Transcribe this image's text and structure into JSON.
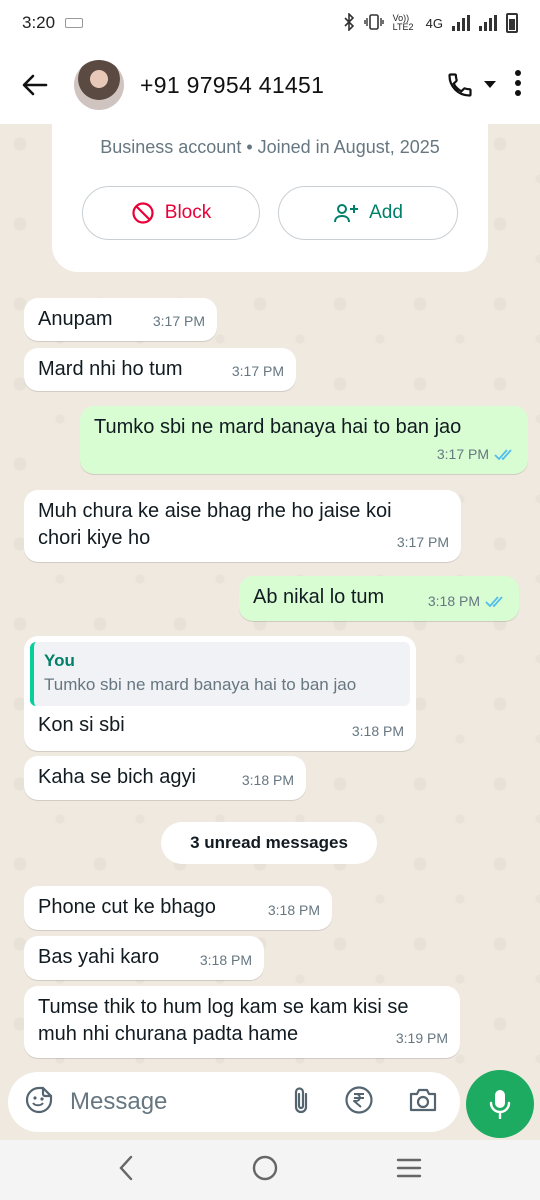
{
  "status_bar": {
    "time": "3:20",
    "network_label": "Vo)) LTE2",
    "network_type": "4G"
  },
  "header": {
    "contact": "+91 97954 41451"
  },
  "business_card": {
    "info": "Business account • Joined in August, 2025",
    "block_label": "Block",
    "add_label": "Add"
  },
  "messages": [
    {
      "direction": "in",
      "text": "Anupam",
      "time": "3:17 PM"
    },
    {
      "direction": "in",
      "text": "Mard nhi ho tum",
      "time": "3:17 PM"
    },
    {
      "direction": "out",
      "text": "Tumko sbi ne mard banaya hai to ban jao",
      "time": "3:17 PM",
      "status": "read"
    },
    {
      "direction": "in",
      "text": "Muh chura ke aise bhag rhe ho jaise koi chori kiye ho",
      "time": "3:17 PM"
    },
    {
      "direction": "out",
      "text": "Ab nikal lo tum",
      "time": "3:18 PM",
      "status": "read"
    },
    {
      "direction": "in",
      "text": "Kon si sbi",
      "time": "3:18 PM",
      "quote": {
        "author": "You",
        "text": "Tumko sbi ne mard banaya hai to ban jao"
      }
    },
    {
      "direction": "in",
      "text": "Kaha se bich agyi",
      "time": "3:18 PM"
    },
    {
      "direction": "in",
      "text": "Phone cut ke bhago",
      "time": "3:18 PM"
    },
    {
      "direction": "in",
      "text": "Bas yahi karo",
      "time": "3:18 PM"
    },
    {
      "direction": "in",
      "text": "Tumse thik to hum log kam se kam kisi se muh nhi churana padta hame",
      "time": "3:19 PM"
    }
  ],
  "unread_divider": "3 unread messages",
  "composer": {
    "placeholder": "Message"
  },
  "colors": {
    "accent": "#008069",
    "outgoing_bubble": "#d9fdd3",
    "block_red": "#ea0038",
    "mic_green": "#1daa61",
    "read_tick": "#53bdeb"
  }
}
